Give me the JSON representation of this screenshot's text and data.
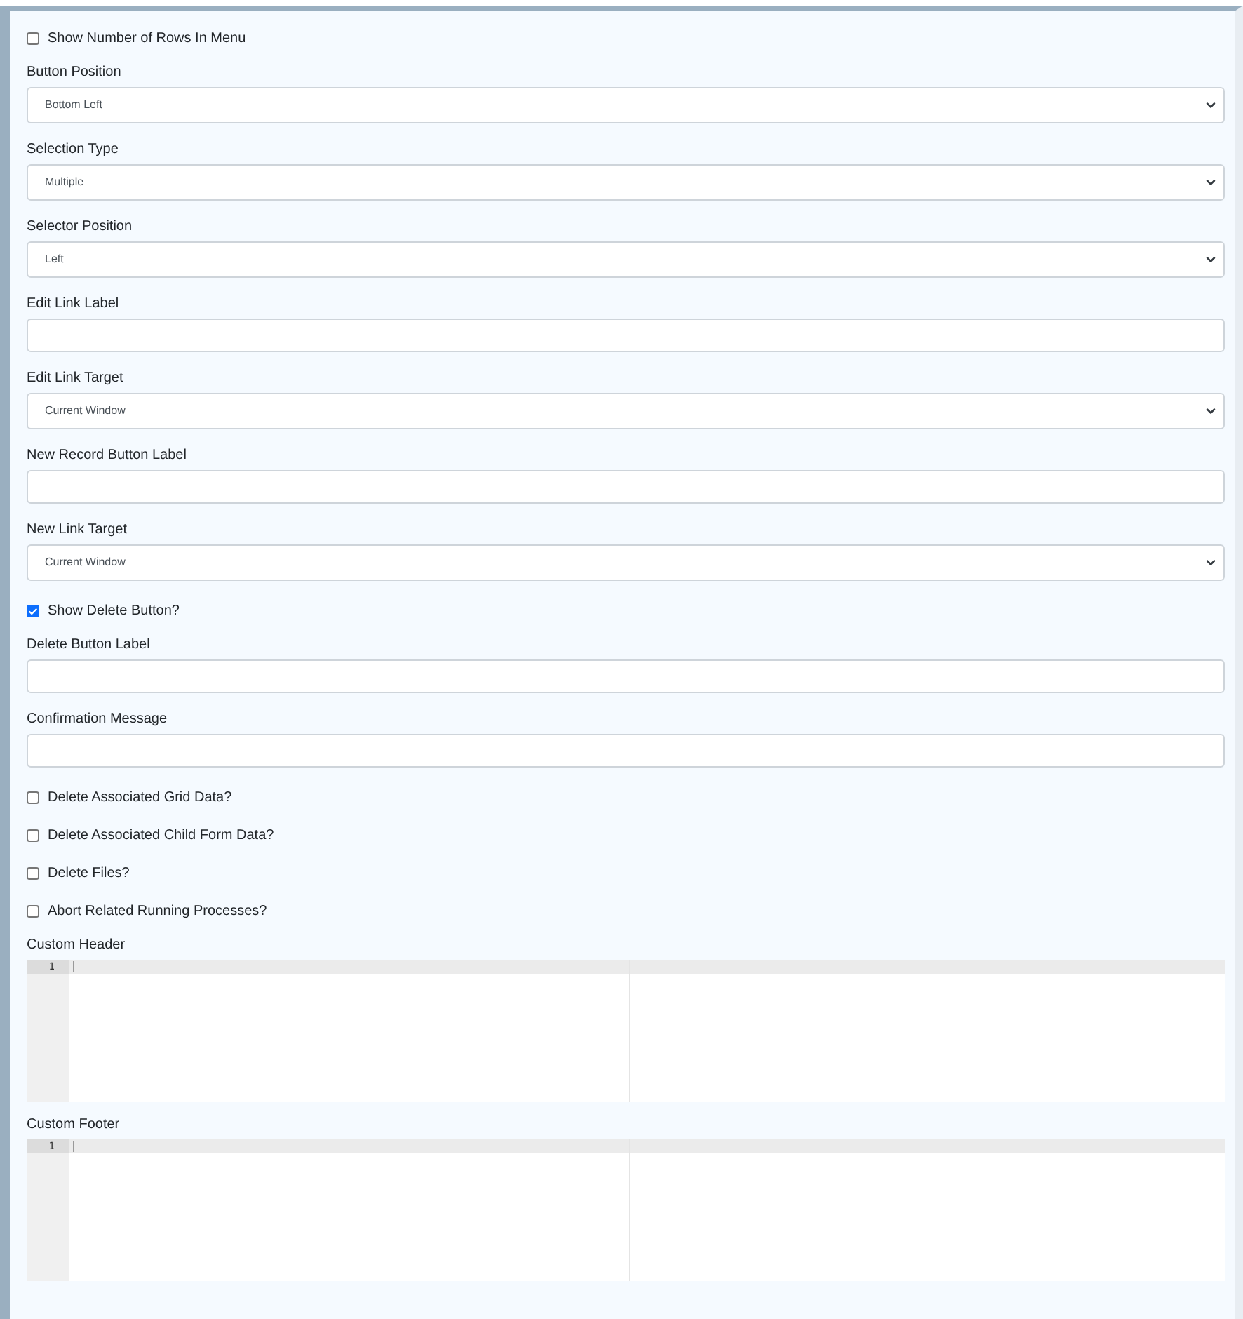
{
  "fields": [
    {
      "kind": "checkbox",
      "label": "Show Number of Rows In Menu",
      "checked": false
    },
    {
      "kind": "select",
      "label": "Button Position",
      "value": "Bottom Left"
    },
    {
      "kind": "select",
      "label": "Selection Type",
      "value": "Multiple"
    },
    {
      "kind": "select",
      "label": "Selector Position",
      "value": "Left"
    },
    {
      "kind": "text",
      "label": "Edit Link Label"
    },
    {
      "kind": "select",
      "label": "Edit Link Target",
      "value": "Current Window"
    },
    {
      "kind": "text",
      "label": "New Record Button Label"
    },
    {
      "kind": "select",
      "label": "New Link Target",
      "value": "Current Window"
    },
    {
      "kind": "checkbox",
      "label": "Show Delete Button?",
      "checked": true
    },
    {
      "kind": "text",
      "label": "Delete Button Label"
    },
    {
      "kind": "text",
      "label": "Confirmation Message"
    },
    {
      "kind": "checkbox",
      "label": "Delete Associated Grid Data?",
      "checked": false
    },
    {
      "kind": "checkbox",
      "label": "Delete Associated Child Form Data?",
      "checked": false
    },
    {
      "kind": "checkbox",
      "label": "Delete Files?",
      "checked": false
    },
    {
      "kind": "checkbox",
      "label": "Abort Related Running Processes?",
      "checked": false
    },
    {
      "kind": "code",
      "label": "Custom Header",
      "line_numbers": [
        "1"
      ]
    },
    {
      "kind": "code",
      "label": "Custom Footer",
      "line_numbers": [
        "1"
      ]
    }
  ]
}
